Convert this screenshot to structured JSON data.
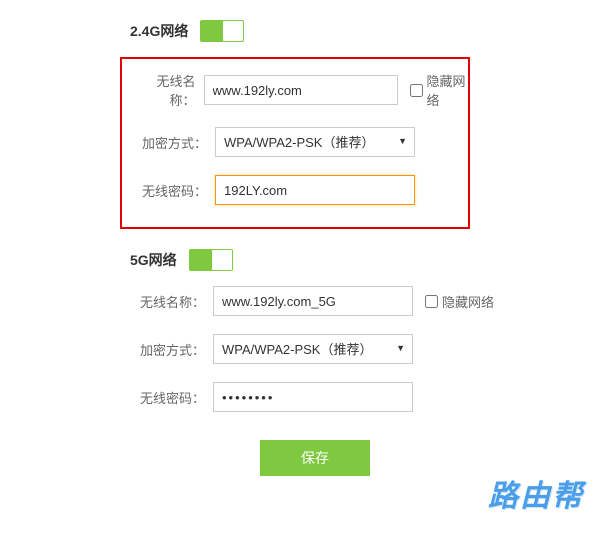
{
  "network24": {
    "title": "2.4G网络",
    "toggle_on": true,
    "ssid_label": "无线名称：",
    "ssid_value": "www.192ly.com",
    "hide_label": "隐藏网络",
    "hide_checked": false,
    "encrypt_label": "加密方式：",
    "encrypt_value": "WPA/WPA2-PSK（推荐）",
    "password_label": "无线密码：",
    "password_value": "192LY.com"
  },
  "network5g": {
    "title": "5G网络",
    "toggle_on": true,
    "ssid_label": "无线名称：",
    "ssid_value": "www.192ly.com_5G",
    "hide_label": "隐藏网络",
    "hide_checked": false,
    "encrypt_label": "加密方式：",
    "encrypt_value": "WPA/WPA2-PSK（推荐）",
    "password_label": "无线密码：",
    "password_value": "••••••••"
  },
  "save_label": "保存",
  "watermark": "路由帮",
  "colors": {
    "accent_green": "#7ec93f",
    "highlight_red": "#e20000",
    "focus_orange": "#f39800",
    "watermark_blue": "#4a9de8"
  }
}
